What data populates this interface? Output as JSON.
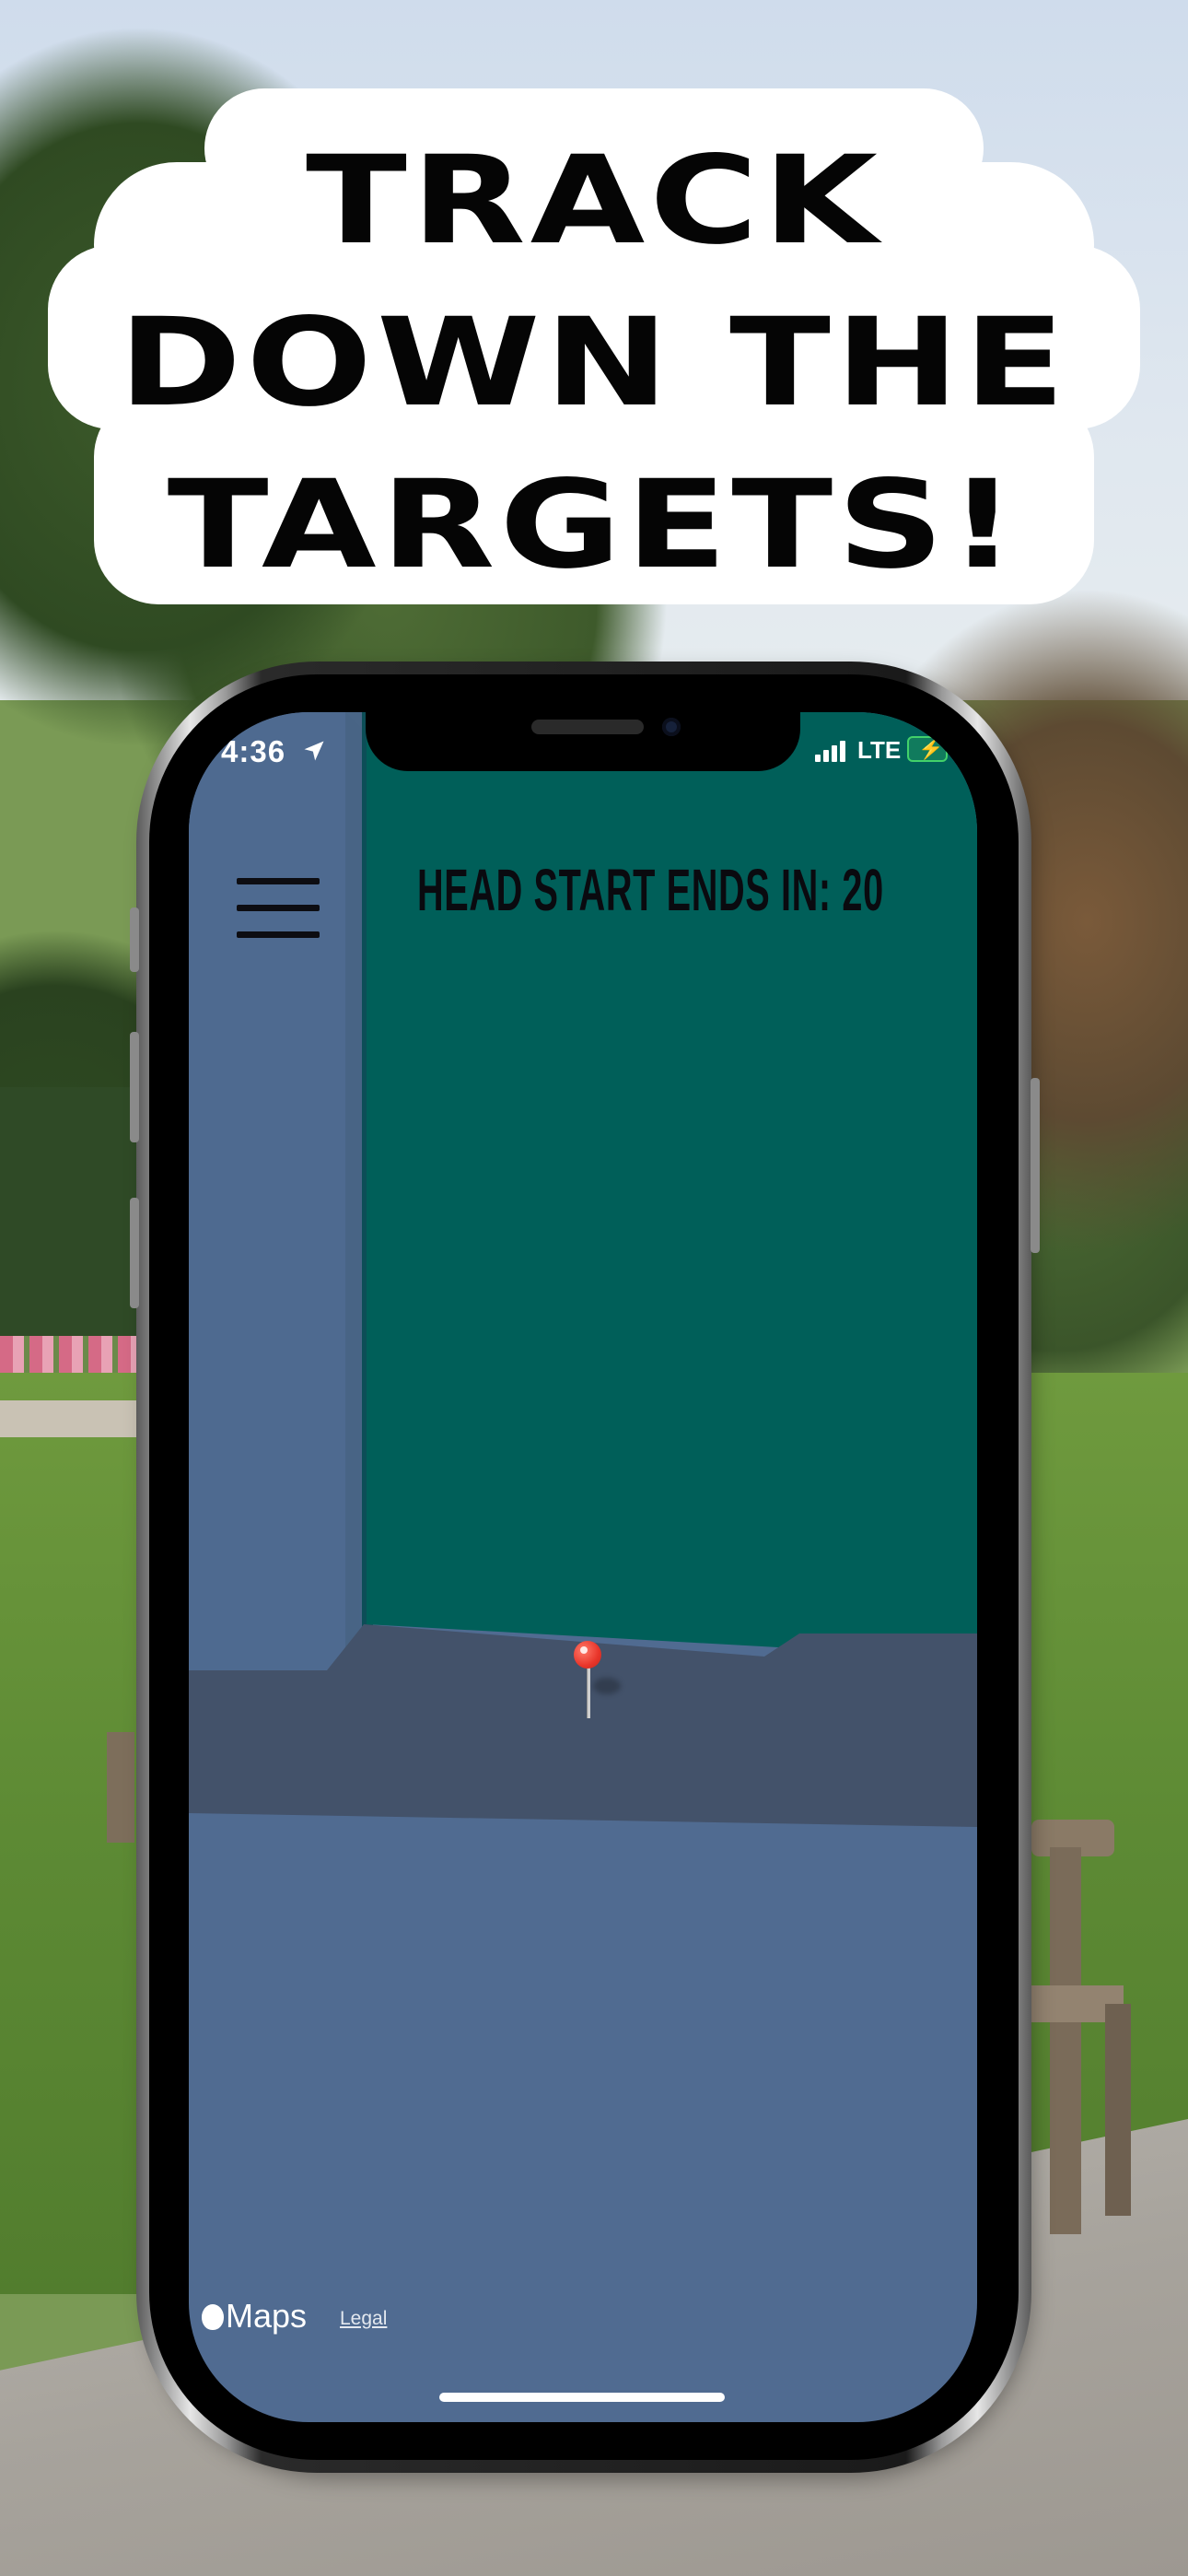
{
  "headline": {
    "lines": [
      "TRACK",
      "DOWN THE",
      "TARGETS!"
    ]
  },
  "status_bar": {
    "time": "4:36",
    "network": "LTE",
    "location_icon": "location-arrow-icon",
    "signal_icon": "cellular-signal-icon",
    "battery_icon": "battery-charging-icon"
  },
  "app": {
    "menu_icon": "hamburger-menu-icon",
    "head_start_text": "HEAD START ENDS IN: 20"
  },
  "map": {
    "attribution": "Maps",
    "legal_label": "Legal",
    "marker_icon": "red-pin-icon"
  },
  "colors": {
    "building": "#005f59",
    "ground": "#506b91",
    "street": "#43526a",
    "pin": "#e8352a"
  }
}
